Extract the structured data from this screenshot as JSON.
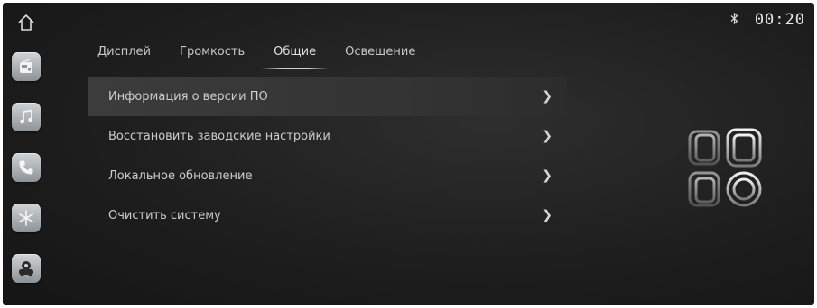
{
  "status": {
    "time": "00:20"
  },
  "dock": [
    {
      "name": "radio-app-icon"
    },
    {
      "name": "music-app-icon"
    },
    {
      "name": "phone-app-icon"
    },
    {
      "name": "climate-app-icon"
    },
    {
      "name": "vehicle-app-icon"
    }
  ],
  "tabs": [
    {
      "label": "Дисплей"
    },
    {
      "label": "Громкость"
    },
    {
      "label": "Общие",
      "active": true
    },
    {
      "label": "Освещение"
    }
  ],
  "menu": [
    {
      "label": "Информация о версии ПО"
    },
    {
      "label": "Восстановить заводские настройки"
    },
    {
      "label": "Локальное обновление"
    },
    {
      "label": "Очистить систему"
    }
  ],
  "colors": {
    "background": "#1e1e1e",
    "accent": "#cfcfcf"
  }
}
